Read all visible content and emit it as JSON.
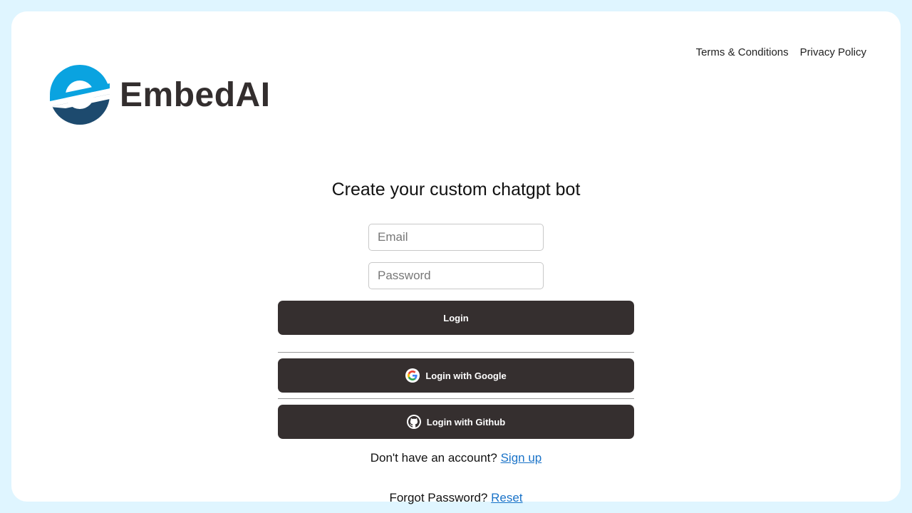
{
  "header": {
    "links": [
      "Terms & Conditions",
      "Privacy Policy"
    ]
  },
  "brand": {
    "name": "EmbedAI",
    "colors": {
      "primary": "#0aa3e0",
      "secondary": "#1d4a6e",
      "text": "#332e2e"
    }
  },
  "main": {
    "title": "Create your custom chatgpt bot",
    "email_placeholder": "Email",
    "password_placeholder": "Password",
    "login_label": "Login",
    "google_label": "Login with Google",
    "github_label": "Login with Github",
    "signup_prompt": "Don't have an account?",
    "signup_link": "Sign up",
    "forgot_prompt": "Forgot Password?",
    "reset_link": "Reset"
  },
  "icons": [
    "embedai-logo-icon",
    "google-icon",
    "github-icon"
  ]
}
